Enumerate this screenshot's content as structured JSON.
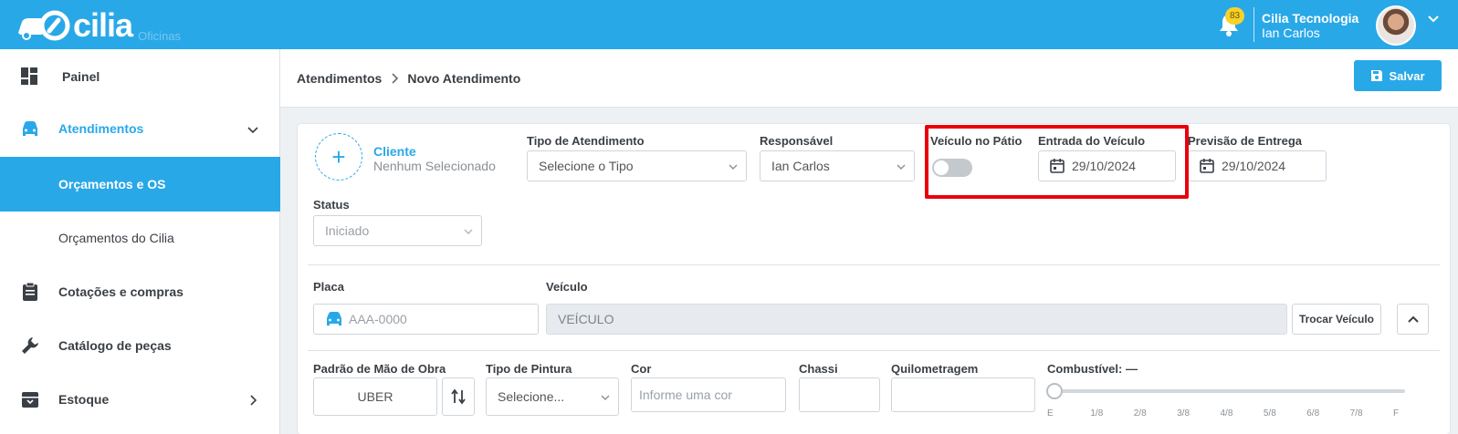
{
  "app": {
    "logo_text": "cilia",
    "logo_sub": "Oficinas",
    "notifications_count": "83",
    "company": "Cilia Tecnologia",
    "user": "Ian Carlos"
  },
  "sidebar": {
    "items": [
      {
        "label": "Painel",
        "icon": "dashboard-icon"
      },
      {
        "label": "Atendimentos",
        "icon": "car-icon"
      },
      {
        "label": "Orçamentos e OS"
      },
      {
        "label": "Orçamentos do Cilia"
      },
      {
        "label": "Cotações e compras",
        "icon": "clipboard-icon"
      },
      {
        "label": "Catálogo de peças",
        "icon": "wrench-icon"
      },
      {
        "label": "Estoque",
        "icon": "archive-icon"
      }
    ]
  },
  "breadcrumb": {
    "root": "Atendimentos",
    "current": "Novo Atendimento"
  },
  "toolbar": {
    "save_label": "Salvar"
  },
  "form": {
    "cliente": {
      "title": "Cliente",
      "subtitle": "Nenhum Selecionado"
    },
    "tipo_atendimento": {
      "label": "Tipo de Atendimento",
      "value": "Selecione o Tipo"
    },
    "responsavel": {
      "label": "Responsável",
      "value": "Ian Carlos"
    },
    "veiculo_patio": {
      "label": "Veículo no Pátio",
      "on": false
    },
    "entrada_veiculo": {
      "label": "Entrada do Veículo",
      "value": "29/10/2024"
    },
    "previsao_entrega": {
      "label": "Previsão de Entrega",
      "value": "29/10/2024"
    },
    "status": {
      "label": "Status",
      "value": "Iniciado"
    },
    "placa": {
      "label": "Placa",
      "placeholder": "AAA-0000"
    },
    "veiculo": {
      "label": "Veículo",
      "value": "VEÍCULO"
    },
    "trocar_veiculo_label": "Trocar Veículo",
    "padrao_mao_obra": {
      "label": "Padrão de Mão de Obra",
      "value": "UBER"
    },
    "tipo_pintura": {
      "label": "Tipo de Pintura",
      "value": "Selecione..."
    },
    "cor": {
      "label": "Cor",
      "placeholder": "Informe uma cor"
    },
    "chassi": {
      "label": "Chassi",
      "value": ""
    },
    "quilometragem": {
      "label": "Quilometragem",
      "value": ""
    },
    "combustivel": {
      "label": "Combustível: —",
      "level": 0,
      "ticks": [
        "E",
        "1/8",
        "2/8",
        "3/8",
        "4/8",
        "5/8",
        "6/8",
        "7/8",
        "F"
      ]
    }
  },
  "colors": {
    "brand": "#29a8e8",
    "highlight": "#e8000c",
    "badge": "#f8d22a"
  }
}
